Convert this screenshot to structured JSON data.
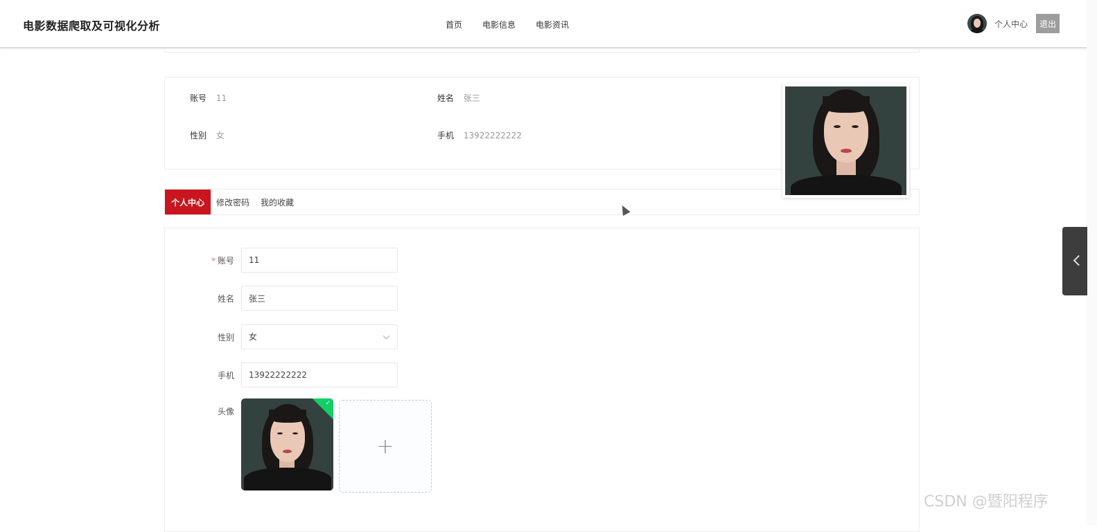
{
  "header": {
    "brand": "电影数据爬取及可视化分析",
    "nav": [
      "首页",
      "电影信息",
      "电影资讯"
    ],
    "user_center": "个人中心",
    "logout": "退出"
  },
  "profile": {
    "account_label": "账号",
    "account_value": "11",
    "name_label": "姓名",
    "name_value": "张三",
    "gender_label": "性别",
    "gender_value": "女",
    "phone_label": "手机",
    "phone_value": "13922222222"
  },
  "tabs": [
    "个人中心",
    "修改密码",
    "我的收藏"
  ],
  "form": {
    "required_mark": "*",
    "account_label": "账号",
    "account_value": "11",
    "name_label": "姓名",
    "name_value": "张三",
    "gender_label": "性别",
    "gender_value": "女",
    "phone_label": "手机",
    "phone_value": "13922222222",
    "avatar_label": "头像",
    "upload_plus": "+",
    "upload_check": "✓"
  },
  "watermark": "CSDN @暨阳程序",
  "colors": {
    "active_tab": "#c9151e",
    "logout_bg": "#9d9d9d",
    "success": "#13ce66",
    "side_toggle": "#3d3d3d"
  },
  "icons": [
    "avatar-image",
    "chevron-down-icon",
    "plus-icon",
    "check-icon",
    "chevron-left-icon",
    "mouse-cursor-icon"
  ]
}
